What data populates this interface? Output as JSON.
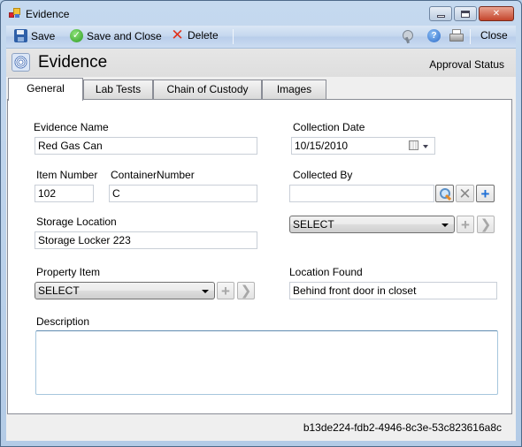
{
  "window": {
    "title": "Evidence",
    "controls": {
      "minimize": "minimize",
      "maximize": "maximize",
      "close": "close"
    }
  },
  "toolbar": {
    "save_label": "Save",
    "save_close_label": "Save and Close",
    "delete_label": "Delete",
    "close_label": "Close",
    "icons": [
      "save-icon",
      "check-icon",
      "delete-x-icon",
      "tools-icon",
      "help-icon",
      "print-icon"
    ]
  },
  "header": {
    "title": "Evidence",
    "approval_status_label": "Approval Status"
  },
  "tabs": [
    {
      "label": "General",
      "active": true
    },
    {
      "label": "Lab Tests",
      "active": false
    },
    {
      "label": "Chain of Custody",
      "active": false
    },
    {
      "label": "Images",
      "active": false
    }
  ],
  "form": {
    "evidence_name": {
      "label": "Evidence Name",
      "value": "Red Gas Can"
    },
    "item_number": {
      "label": "Item Number",
      "value": "102"
    },
    "container_number": {
      "label": "ContainerNumber",
      "value": "C"
    },
    "storage_location": {
      "label": "Storage Location",
      "value": "Storage Locker 223"
    },
    "property_item": {
      "label": "Property Item",
      "value": "SELECT"
    },
    "collection_date": {
      "label": "Collection Date",
      "value": "10/15/2010"
    },
    "collected_by": {
      "label": "Collected By",
      "value": "",
      "select_value": "SELECT"
    },
    "location_found": {
      "label": "Location Found",
      "value": "Behind front door in closet"
    },
    "description": {
      "label": "Description",
      "value": ""
    }
  },
  "status_bar": {
    "record_id": "b13de224-fdb2-4946-8c3e-53c823616a8c"
  }
}
